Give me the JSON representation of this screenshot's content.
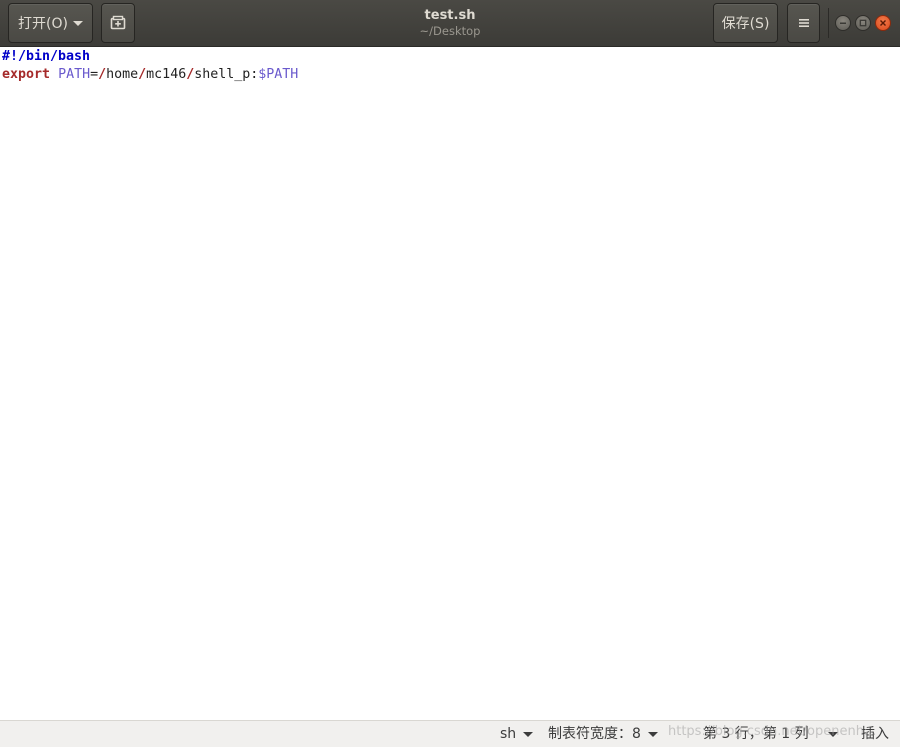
{
  "header": {
    "open_label": "打开(O)",
    "save_label": "保存(S)",
    "title": "test.sh",
    "subtitle": "~/Desktop",
    "newdoc_icon": "new-document-icon",
    "menu_icon": "hamburger-menu-icon"
  },
  "editor": {
    "lines": [
      {
        "shebang": "#!/bin/bash"
      },
      {
        "keyword": "export",
        "var_name": "PATH",
        "equals": "=",
        "slash1": "/",
        "seg1": "home",
        "slash2": "/",
        "seg2": "mc146",
        "slash3": "/",
        "seg3": "shell_p:",
        "var_ref": "$PATH"
      }
    ]
  },
  "status": {
    "language": "sh",
    "tab_width": "制表符宽度：8",
    "position": "第 3 行，第 1 列",
    "mode": "插入"
  },
  "watermark": "https://blog.csdn.net/openenh..."
}
